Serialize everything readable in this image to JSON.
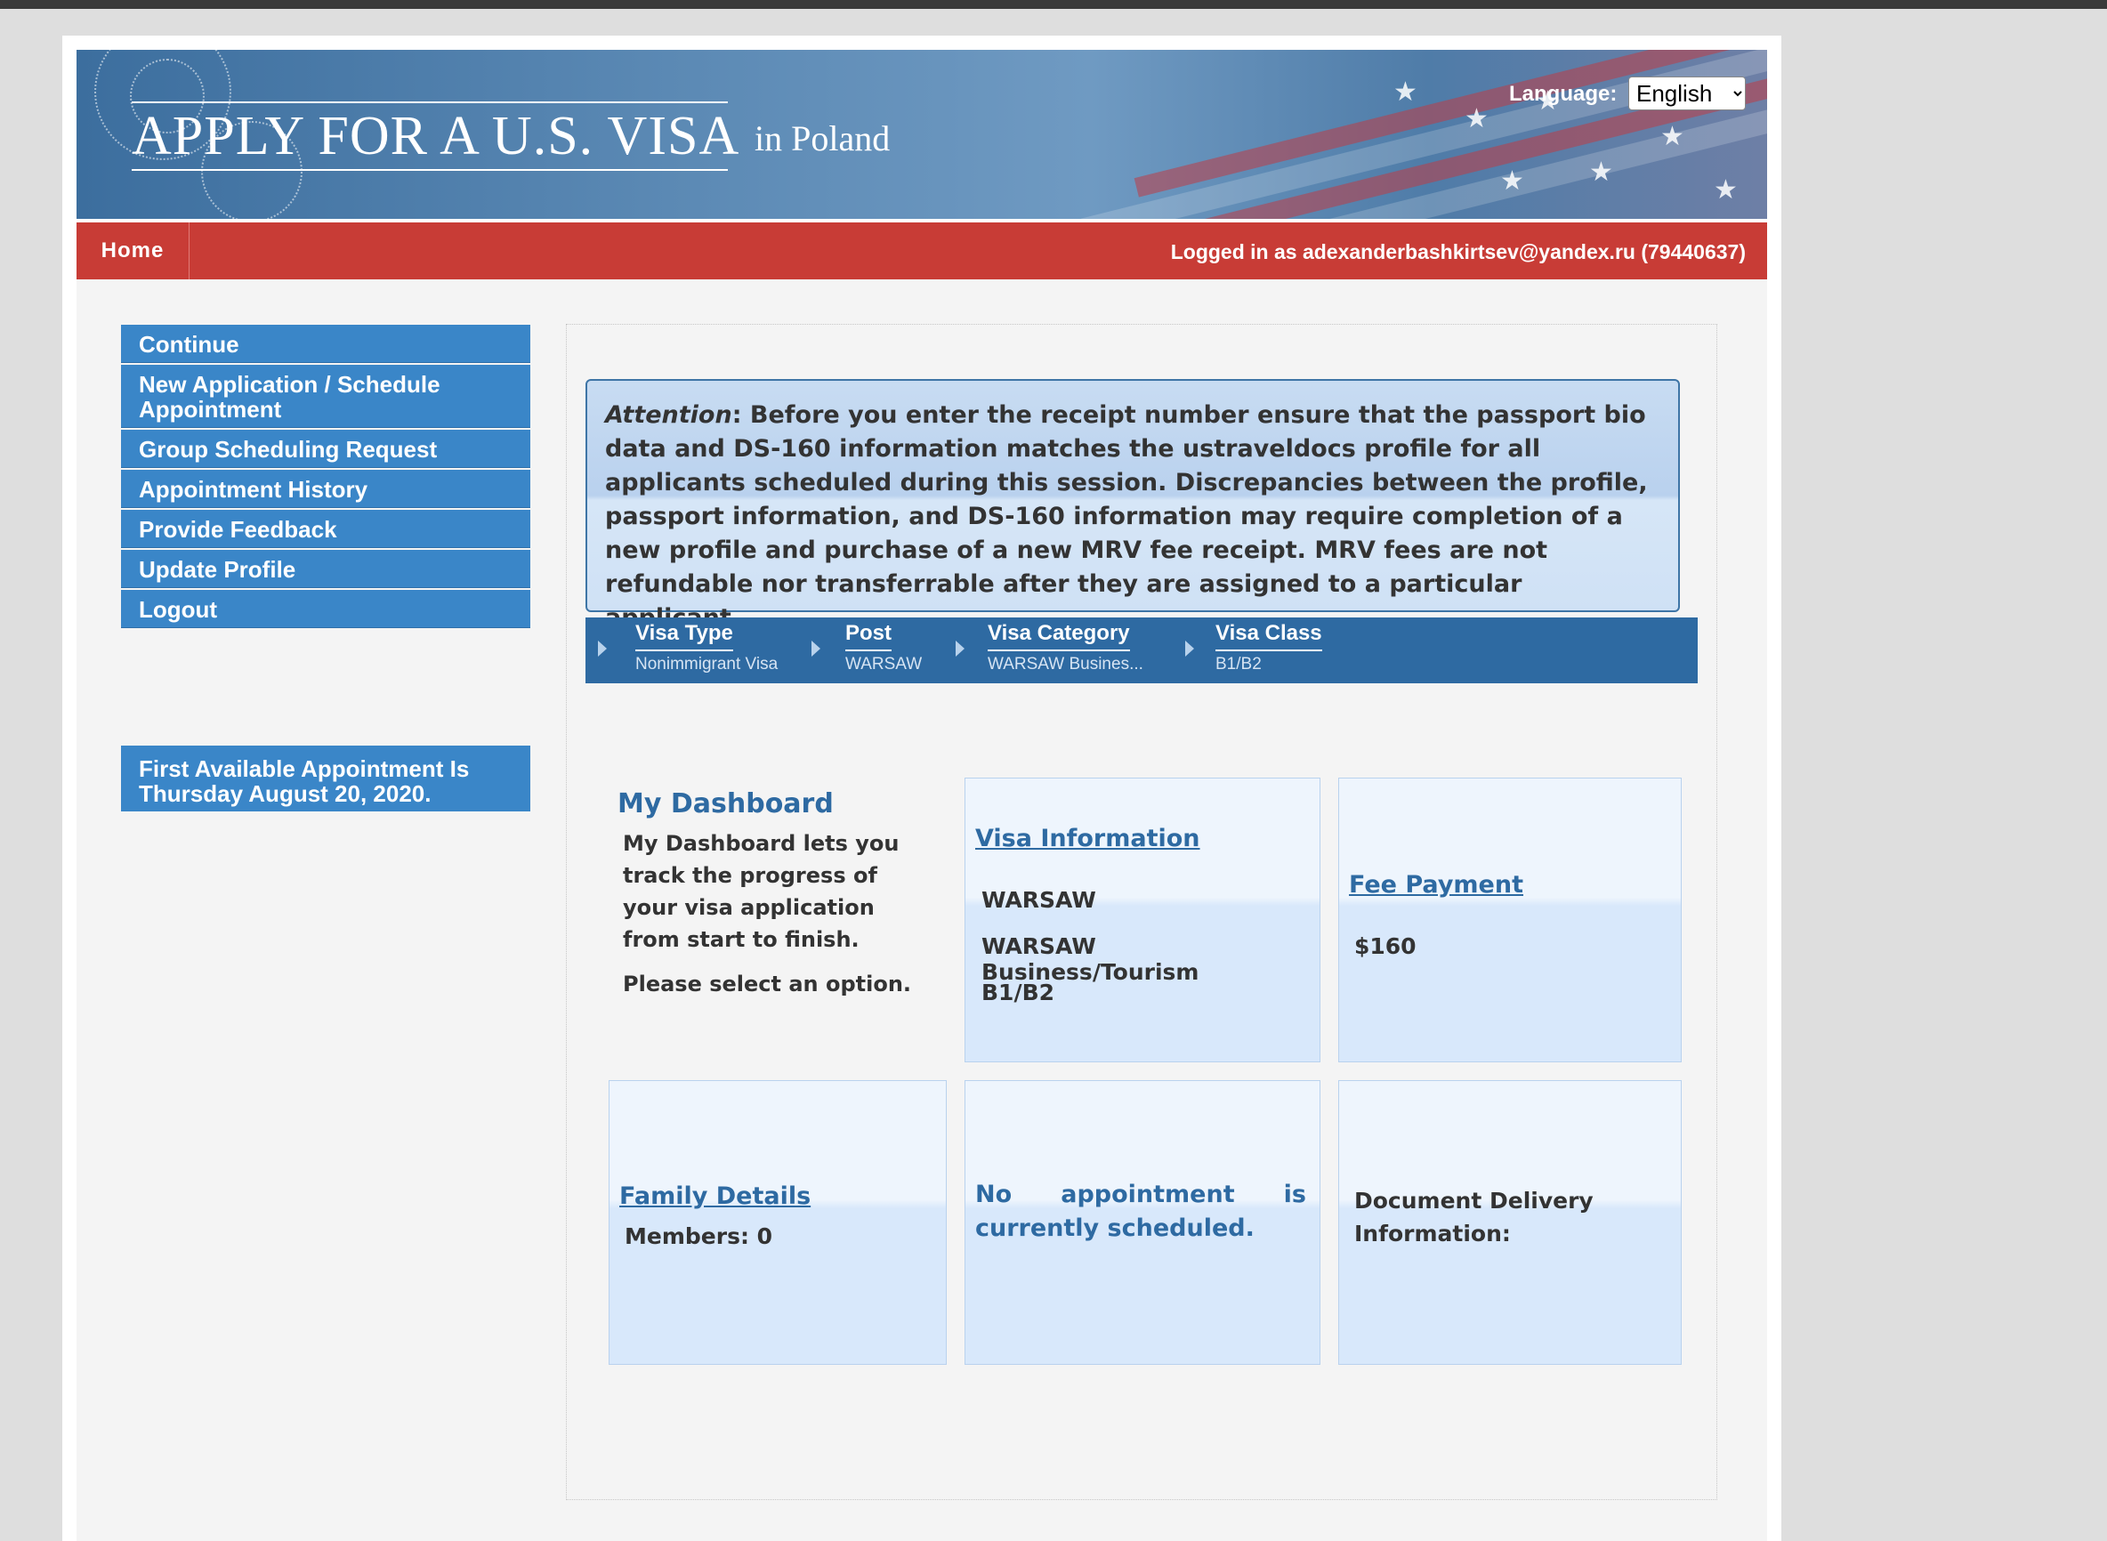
{
  "header": {
    "title": "APPLY FOR A U.S. VISA",
    "country": "in  Poland",
    "language_label": "Language:",
    "language_value": "English"
  },
  "nav": {
    "home": "Home",
    "logged_in": "Logged in as  adexanderbashkirtsev@yandex.ru (79440637)"
  },
  "sidebar": {
    "items": [
      {
        "label": "Continue"
      },
      {
        "label": "New Application / Schedule Appointment"
      },
      {
        "label": "Group Scheduling Request"
      },
      {
        "label": "Appointment History"
      },
      {
        "label": "Provide Feedback"
      },
      {
        "label": "Update Profile"
      },
      {
        "label": "Logout"
      }
    ],
    "first_available": "First Available Appointment Is Thursday August 20, 2020."
  },
  "attention": {
    "prefix": "Attention",
    "text": ": Before you enter the receipt number ensure that the passport bio data and DS-160 information matches the ustraveldocs profile for all applicants scheduled during this session. Discrepancies between the profile, passport information, and DS-160 information may require completion of a new profile and purchase of a new MRV fee receipt. MRV fees are not refundable nor transferrable after they are assigned to a particular applicant."
  },
  "breadcrumbs": [
    {
      "label": "Visa Type",
      "value": "Nonimmigrant Visa"
    },
    {
      "label": "Post",
      "value": "WARSAW"
    },
    {
      "label": "Visa Category",
      "value": "WARSAW Busines..."
    },
    {
      "label": "Visa Class",
      "value": "B1/B2"
    }
  ],
  "dashboard": {
    "title": "My Dashboard",
    "description": "My Dashboard lets you track the progress of your visa application from start to finish.",
    "prompt": "Please select an option.",
    "visa_info": {
      "title": "Visa Information",
      "post": "WARSAW",
      "category": "WARSAW Business/Tourism",
      "class": "B1/B2"
    },
    "fee_payment": {
      "title": "Fee Payment",
      "amount": "$160"
    },
    "family": {
      "title": "Family Details",
      "members": "Members: 0"
    },
    "appointment": {
      "status_words": [
        "No",
        "appointment",
        "is"
      ],
      "status_line2": "currently scheduled."
    },
    "document_delivery": {
      "title": "Document Delivery Information:"
    }
  },
  "colors": {
    "nav_red": "#c83c36",
    "sidebar_blue": "#3a86c8",
    "link_blue": "#2e6aa2",
    "crumb_bar": "#2e6aa2"
  }
}
